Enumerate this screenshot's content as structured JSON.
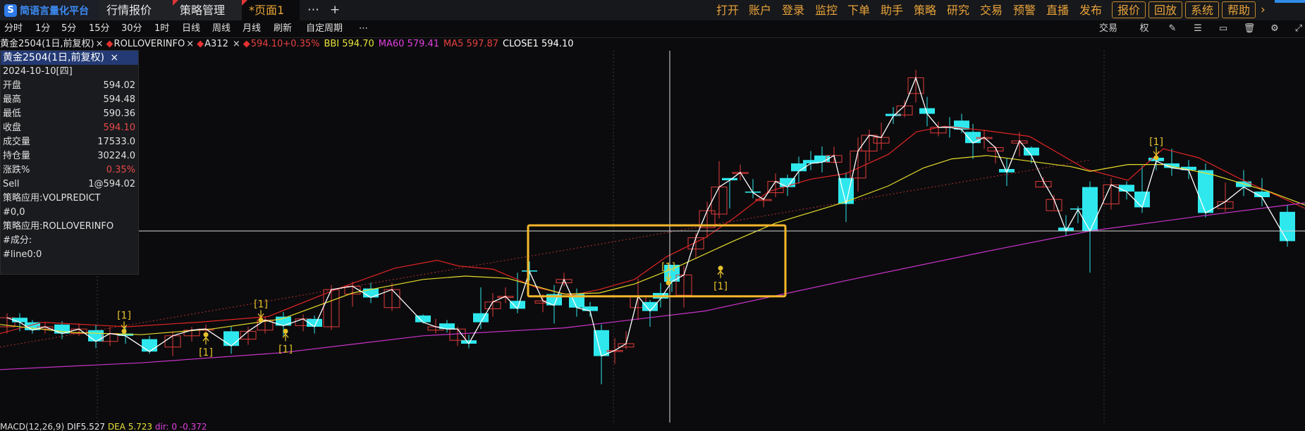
{
  "app": {
    "logo_text": "简语言量化平台",
    "logo_glyph": "S",
    "tabs": [
      {
        "label": "行情报价"
      },
      {
        "label": "策略管理"
      },
      {
        "label": "*页面1"
      }
    ],
    "more_icon": "⋯",
    "add_icon": "+",
    "menu": [
      "打开",
      "账户",
      "登录",
      "监控",
      "下单",
      "助手",
      "策略",
      "研究",
      "交易",
      "预警",
      "直播",
      "发布"
    ],
    "menu_buttons": [
      "报价",
      "回放",
      "系统",
      "帮助"
    ],
    "expand_icon": "›"
  },
  "periods": [
    "分时",
    "1分",
    "5分",
    "15分",
    "30分",
    "1时",
    "日线",
    "周线",
    "月线",
    "刷新",
    "自定周期",
    "⋯"
  ],
  "toolbar_right": {
    "trade_label": "交易",
    "icons": [
      "weight-icon",
      "pencil-icon",
      "sliders-icon",
      "layout-icon",
      "trash-icon",
      "settings-icon",
      "pin-icon"
    ],
    "glyphs": [
      "权",
      "✎",
      "☰",
      "▭",
      "🗑",
      "⚙",
      "⤢"
    ]
  },
  "legend": {
    "symbol": "黄金2504(1日,前复权)",
    "rollover": "ROLLOVERINFO",
    "a312": "A312",
    "price": "594.10+0.35%",
    "bbi": "BBI 594.70",
    "ma60": "MA60 579.41",
    "ma5": "MA5 597.87",
    "close1": "CLOSE1 594.10",
    "close_x": "×",
    "colors": {
      "bbi": "#e8e23a",
      "ma60": "#e040e0",
      "ma5": "#e84040",
      "close1": "#ffffff",
      "price": "#e84040"
    }
  },
  "info": {
    "title": "黄金2504(1日,前复权)",
    "close_icon": "×",
    "date": "2024-10-10[四]",
    "rows": [
      {
        "label": "开盘",
        "value": "594.02"
      },
      {
        "label": "最高",
        "value": "594.48"
      },
      {
        "label": "最低",
        "value": "590.36"
      },
      {
        "label": "收盘",
        "value": "594.10",
        "red": true
      },
      {
        "label": "成交量",
        "value": "17533.0"
      },
      {
        "label": "持仓量",
        "value": "30224.0"
      },
      {
        "label": "涨跌%",
        "value": "0.35%",
        "red": true
      },
      {
        "label": "Sell",
        "value": "1@594.02"
      }
    ],
    "notes": [
      "策略应用:VOLPREDICT",
      "#0,0",
      "策略应用:ROLLOVERINFO",
      "#成分:",
      "#line0:0"
    ]
  },
  "macd": {
    "prefix": "MACD(12,26,9)",
    "dif": "DIF5.527",
    "dea": "DEA 5.723",
    "macd": "dir: 0 -0.372"
  },
  "signal_label": "[1]",
  "chart_data": {
    "type": "candlestick",
    "candles": [
      [
        600,
        586.6,
        586.0,
        585.9,
        586.7
      ],
      [
        618,
        585.3,
        585.6,
        585.0,
        586.3
      ],
      [
        634,
        585.9,
        585.4,
        585.1,
        586.2
      ],
      [
        649,
        584.4,
        585.4,
        583.9,
        585.6
      ],
      [
        665,
        584.4,
        584.1,
        583.7,
        584.9
      ],
      [
        682,
        586.8,
        586.0,
        585.4,
        589.1
      ],
      [
        699,
        587.2,
        587.8,
        586.5,
        588.6
      ],
      [
        717,
        588.2,
        588.3,
        587.7,
        589.1
      ],
      [
        734,
        587.9,
        587.2,
        586.8,
        590.4
      ],
      [
        751,
        590.6,
        590.5,
        589.7,
        591.4
      ],
      [
        770,
        587.7,
        587.9,
        586.9,
        588.5
      ],
      [
        786,
        588.5,
        587.5,
        585.9,
        589.3
      ],
      [
        800,
        589.5,
        589.8,
        589.2,
        590.4
      ],
      [
        818,
        588.5,
        587.3,
        586.5,
        589.0
      ],
      [
        837,
        587.4,
        587.0,
        586.5,
        587.8
      ],
      [
        853,
        585.3,
        583.0,
        580.5,
        585.8
      ],
      [
        872,
        583.4,
        583.5,
        582.3,
        584.6
      ],
      [
        888,
        583.8,
        584.1,
        583.6,
        585.2
      ],
      [
        905,
        587.3,
        588.3,
        586.2,
        589.9
      ],
      [
        922,
        587.8,
        587.0,
        585.6,
        588.0
      ],
      [
        937,
        588.6,
        588.1,
        587.3,
        589.5
      ],
      [
        953,
        591.1,
        589.6,
        588.7,
        591.1
      ],
      [
        970,
        588.4,
        590.2,
        587.3,
        591.0
      ],
      [
        987,
        592.5,
        593.5,
        591.6,
        593.9
      ],
      [
        1003,
        594.4,
        595.9,
        593.5,
        596.7
      ],
      [
        1020,
        595.6,
        598.0,
        595.2,
        600.3
      ],
      [
        1035,
        598.8,
        598.6,
        596.1,
        598.8
      ],
      [
        1050,
        599.2,
        599.3,
        598.6,
        600.0
      ],
      [
        1068,
        597.6,
        597.5,
        597.0,
        598.7
      ],
      [
        1083,
        596.8,
        596.9,
        596.2,
        597.1
      ],
      [
        1100,
        597.5,
        598.5,
        597.1,
        599.2
      ],
      [
        1117,
        598.8,
        598.0,
        597.2,
        599.1
      ],
      [
        1133,
        600.1,
        599.4,
        598.3,
        600.7
      ],
      [
        1150,
        600.4,
        600.1,
        599.5,
        601.2
      ],
      [
        1166,
        600.8,
        600.2,
        599.3,
        601.6
      ],
      [
        1183,
        600.2,
        600.8,
        600.1,
        601.6
      ],
      [
        1200,
        598.8,
        596.5,
        594.9,
        599.3
      ],
      [
        1217,
        598.8,
        601.2,
        597.6,
        602.4
      ],
      [
        1233,
        601.2,
        602.6,
        600.3,
        603.1
      ],
      [
        1250,
        601.9,
        602.4,
        601.3,
        603.7
      ],
      [
        1267,
        604.5,
        604.3,
        603.6,
        605.1
      ],
      [
        1283,
        604.4,
        605.2,
        604.2,
        605.7
      ],
      [
        1299,
        606.3,
        607.7,
        605.5,
        608.4
      ],
      [
        1315,
        605.0,
        604.5,
        603.4,
        606.0
      ],
      [
        1331,
        602.8,
        603.3,
        602.5,
        603.8
      ],
      [
        1347,
        603.4,
        603.3,
        602.4,
        604.2
      ],
      [
        1364,
        603.9,
        603.1,
        602.8,
        604.5
      ],
      [
        1380,
        602.9,
        601.9,
        600.5,
        603.6
      ],
      [
        1396,
        602.3,
        602.4,
        601.4,
        603.1
      ],
      [
        1412,
        601.2,
        601.5,
        600.1,
        601.6
      ],
      [
        1428,
        599.6,
        599.3,
        598.1,
        600.6
      ],
      [
        1446,
        601.9,
        602.1,
        600.7,
        602.9
      ],
      [
        1463,
        601.5,
        600.8,
        600.1,
        601.6
      ],
      [
        1480,
        598.0,
        598.5,
        598.0,
        598.9
      ],
      [
        1495,
        595.9,
        596.9,
        596.0,
        597.3
      ],
      [
        1512,
        594.4,
        594.1,
        593.7,
        595.5
      ],
      [
        1529,
        596.1,
        596.0,
        594.8,
        596.3
      ],
      [
        1546,
        598.0,
        594.1,
        590.4,
        598.5
      ]
    ],
    "candle_fields": [
      "x_px",
      "open",
      "close",
      "low",
      "high"
    ],
    "series": [
      {
        "name": "MA5",
        "color": "#e02424",
        "values": [
          [
            0,
            585.0
          ],
          [
            60,
            586.0
          ],
          [
            180,
            585.6
          ],
          [
            280,
            586.0
          ],
          [
            380,
            586.5
          ],
          [
            480,
            589.0
          ],
          [
            560,
            590.8
          ],
          [
            620,
            591.5
          ],
          [
            650,
            591.0
          ],
          [
            700,
            590.7
          ],
          [
            760,
            589.1
          ],
          [
            810,
            588.4
          ],
          [
            850,
            588.9
          ],
          [
            900,
            589.8
          ],
          [
            945,
            591.8
          ],
          [
            1000,
            593.5
          ],
          [
            1040,
            595.2
          ],
          [
            1090,
            597.6
          ],
          [
            1150,
            598.7
          ],
          [
            1200,
            599.2
          ],
          [
            1260,
            600.9
          ],
          [
            1300,
            602.9
          ],
          [
            1340,
            603.4
          ],
          [
            1400,
            603.0
          ],
          [
            1460,
            602.5
          ],
          [
            1540,
            599.6
          ]
        ]
      },
      {
        "name": "BBI",
        "color": "#e6dd2a",
        "values": [
          [
            0,
            585.8
          ],
          [
            100,
            585.1
          ],
          [
            200,
            584.9
          ],
          [
            300,
            585.4
          ],
          [
            400,
            586.3
          ],
          [
            500,
            588.6
          ],
          [
            600,
            589.8
          ],
          [
            660,
            590.1
          ],
          [
            720,
            589.9
          ],
          [
            800,
            588.5
          ],
          [
            850,
            588.6
          ],
          [
            900,
            589.4
          ],
          [
            960,
            590.9
          ],
          [
            1040,
            593.2
          ],
          [
            1100,
            594.8
          ],
          [
            1200,
            596.7
          ],
          [
            1260,
            598.1
          ],
          [
            1310,
            599.7
          ],
          [
            1350,
            600.5
          ],
          [
            1400,
            600.8
          ],
          [
            1460,
            600.3
          ],
          [
            1520,
            599.8
          ],
          [
            1546,
            599.4
          ]
        ]
      },
      {
        "name": "MA60",
        "color": "#cc33cc",
        "values": [
          [
            0,
            581.8
          ],
          [
            200,
            582.4
          ],
          [
            400,
            583.3
          ],
          [
            600,
            584.8
          ],
          [
            800,
            585.5
          ],
          [
            1000,
            587.0
          ],
          [
            1200,
            589.7
          ],
          [
            1400,
            592.3
          ],
          [
            1546,
            594.1
          ]
        ]
      },
      {
        "name": "CLOSE1",
        "color": "#ffffff",
        "values": [
          [
            600,
            586.0
          ],
          [
            618,
            585.6
          ],
          [
            634,
            585.4
          ],
          [
            649,
            585.4
          ],
          [
            665,
            584.1
          ],
          [
            682,
            586.0
          ],
          [
            699,
            587.8
          ],
          [
            717,
            588.3
          ],
          [
            734,
            587.2
          ],
          [
            751,
            590.5
          ],
          [
            770,
            587.9
          ],
          [
            786,
            587.5
          ],
          [
            800,
            589.8
          ],
          [
            818,
            587.3
          ],
          [
            837,
            587.0
          ],
          [
            853,
            583.0
          ],
          [
            872,
            583.5
          ],
          [
            888,
            584.1
          ],
          [
            905,
            588.3
          ],
          [
            922,
            587.0
          ],
          [
            937,
            588.1
          ],
          [
            953,
            589.6
          ],
          [
            970,
            590.2
          ],
          [
            987,
            593.5
          ],
          [
            1003,
            595.9
          ],
          [
            1020,
            598.0
          ],
          [
            1035,
            598.6
          ],
          [
            1050,
            599.3
          ],
          [
            1068,
            597.5
          ],
          [
            1083,
            596.9
          ],
          [
            1100,
            598.5
          ],
          [
            1117,
            598.0
          ],
          [
            1133,
            599.4
          ],
          [
            1150,
            600.1
          ],
          [
            1166,
            600.2
          ],
          [
            1183,
            600.8
          ],
          [
            1200,
            596.5
          ],
          [
            1217,
            601.2
          ],
          [
            1233,
            602.6
          ],
          [
            1250,
            602.4
          ],
          [
            1267,
            604.3
          ],
          [
            1283,
            605.2
          ],
          [
            1299,
            607.7
          ],
          [
            1315,
            604.5
          ],
          [
            1331,
            603.3
          ],
          [
            1347,
            603.3
          ],
          [
            1364,
            603.1
          ],
          [
            1380,
            601.9
          ],
          [
            1396,
            602.4
          ],
          [
            1412,
            601.5
          ],
          [
            1428,
            599.3
          ],
          [
            1446,
            602.1
          ],
          [
            1463,
            600.8
          ],
          [
            1480,
            598.5
          ],
          [
            1495,
            596.9
          ],
          [
            1512,
            594.1
          ],
          [
            1529,
            596.0
          ],
          [
            1546,
            594.1
          ]
        ]
      }
    ],
    "dotted_trend": {
      "from": [
        0,
        583.8
      ],
      "to": [
        1546,
        600.4
      ],
      "color": "#b03030"
    },
    "crosshair": {
      "price": 594.1
    },
    "highlight_box": {
      "x_from": 749,
      "x_to": 1114,
      "price_top": 594.6,
      "price_bottom": 588.3,
      "color": "#f5b82a"
    },
    "signals": [
      {
        "x": 176,
        "price": 585.2,
        "label_above": true
      },
      {
        "x": 292,
        "price": 584.9,
        "label_above": false
      },
      {
        "x": 370,
        "price": 586.2,
        "label_above": true
      },
      {
        "x": 405,
        "price": 585.2,
        "label_above": false
      },
      {
        "x": 948,
        "price": 589.5,
        "label_above": true
      },
      {
        "x": 1022,
        "price": 590.8,
        "label_above": false
      },
      {
        "x": 1640,
        "price": 600.6,
        "label_above": true
      }
    ],
    "ylim": [
      581,
      610
    ]
  }
}
